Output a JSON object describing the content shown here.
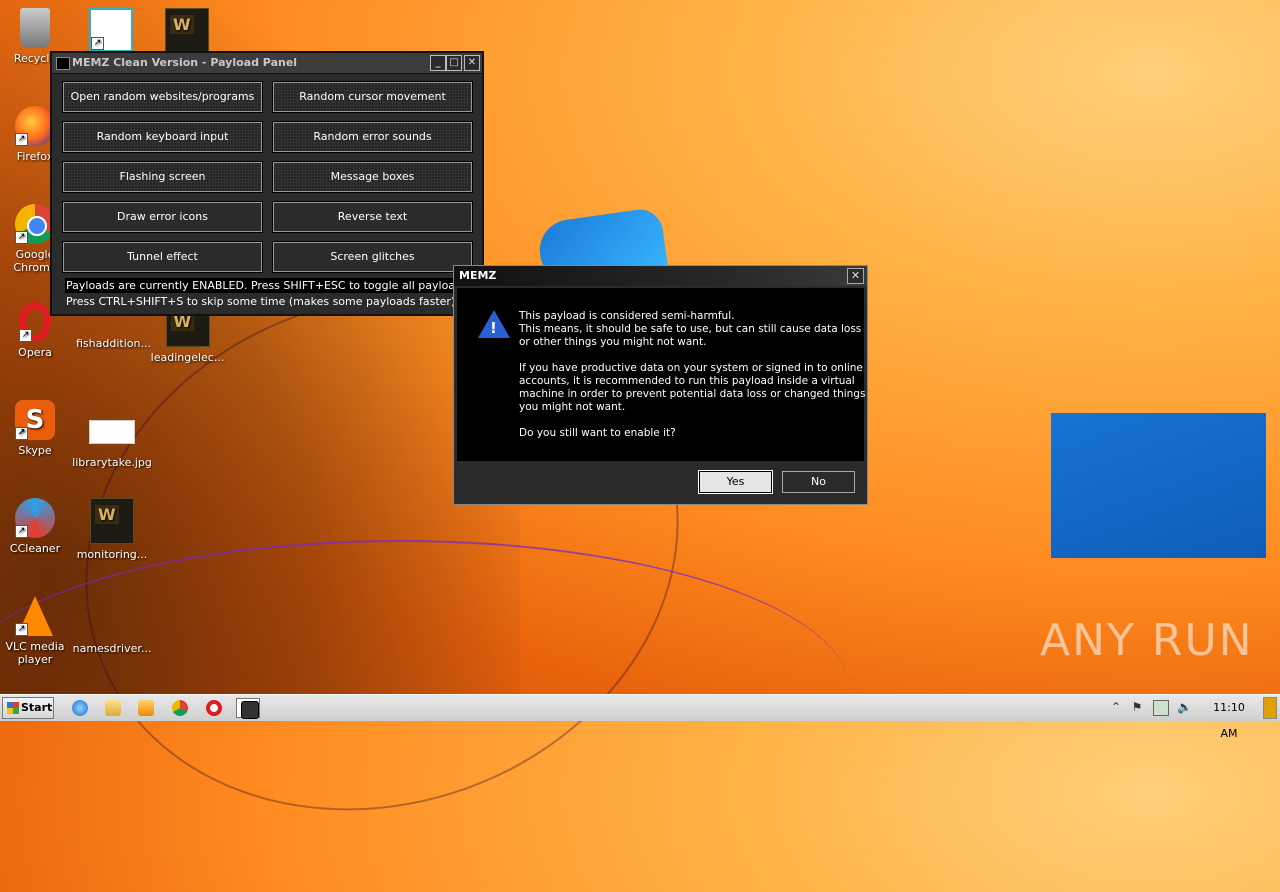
{
  "desktop": {
    "icons": [
      {
        "label": "Recycle"
      },
      {
        "label": "Firefox"
      },
      {
        "label": "Google Chrome"
      },
      {
        "label": "Opera"
      },
      {
        "label": "Skype"
      },
      {
        "label": "CCleaner"
      },
      {
        "label": "VLC media player"
      },
      {
        "label": "fishaddition...."
      },
      {
        "label": "leadingelec..."
      },
      {
        "label": "librarytake.jpg"
      },
      {
        "label": "monitoring..."
      },
      {
        "label": "namesdriver..."
      }
    ]
  },
  "panel": {
    "title": "MEMZ Clean Version - Payload Panel",
    "buttons": [
      "Open random websites/programs",
      "Random cursor movement",
      "Random keyboard input",
      "Random error sounds",
      "Flashing screen",
      "Message boxes",
      "Draw error icons",
      "Reverse text",
      "Tunnel effect",
      "Screen glitches"
    ],
    "status_line1": "Payloads are currently ENABLED. Press SHIFT+ESC to toggle all payloads!",
    "status_line2": "Press CTRL+SHIFT+S to skip some time (makes some payloads faster)"
  },
  "dialog": {
    "title": "MEMZ",
    "line1": "This payload is considered semi-harmful.",
    "line2": "This means, it should be safe to use, but can still cause data loss",
    "line3": "or other things you might not want.",
    "line4": "If you have productive data on your system or signed in to online",
    "line5": "accounts, it is recommended to run this payload inside a virtual",
    "line6": "machine in order to prevent potential data loss or changed things",
    "line7": "you might not want.",
    "line8": "Do you still want to enable it?",
    "yes": "Yes",
    "no": "No"
  },
  "watermark": "ANY RUN",
  "taskbar": {
    "start": "Start",
    "clock": "11:10 AM"
  }
}
